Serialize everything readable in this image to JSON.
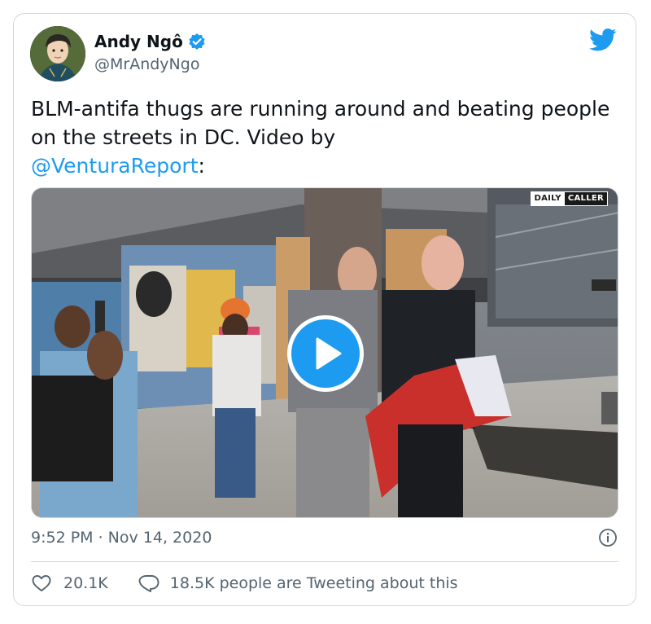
{
  "author": {
    "display_name": "Andy Ngô",
    "handle": "@MrAndyNgo",
    "verified": true,
    "avatar_icon": "avatar-illustration"
  },
  "platform_icon": "twitter-bird-icon",
  "tweet": {
    "text": "BLM-antifa thugs are running around and beating people on the streets in DC. Video by",
    "mention": "@VenturaReport",
    "trailing": ":"
  },
  "media": {
    "type": "video",
    "watermark_left": "DAILY",
    "watermark_right": "CALLER",
    "play_icon": "play-icon"
  },
  "meta": {
    "timestamp": "9:52 PM · Nov 14, 2020",
    "info_icon": "info-icon"
  },
  "actions": {
    "likes": "20.1K",
    "replies_text": "18.5K people are Tweeting about this"
  },
  "colors": {
    "accent": "#1d9bf0",
    "text": "#0f1419",
    "secondary": "#536471",
    "border": "#cfd9de"
  }
}
